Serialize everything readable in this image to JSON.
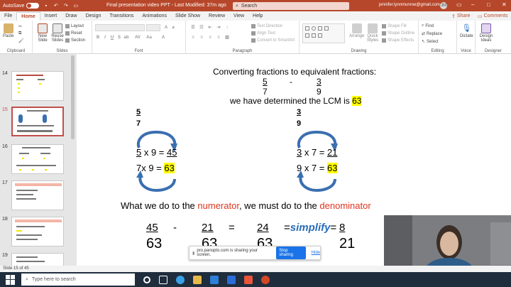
{
  "titlebar": {
    "autosave": "AutoSave",
    "autosave_state": "Off",
    "doc_title": "Final presentation video PPT  -  Last Modified: 37m ago",
    "search_placeholder": "Search",
    "user": "jennifer.lynnmunroe@gmail.com",
    "avatar_initials": "JM"
  },
  "tabs": [
    "File",
    "Home",
    "Insert",
    "Draw",
    "Design",
    "Transitions",
    "Animations",
    "Slide Show",
    "Review",
    "View",
    "Help"
  ],
  "active_tab": "Home",
  "share_label": "Share",
  "comments_label": "Comments",
  "ribbon": {
    "groups": {
      "clipboard": "Clipboard",
      "slides": "Slides",
      "font": "Font",
      "paragraph": "Paragraph",
      "drawing": "Drawing",
      "editing": "Editing",
      "voice": "Voice",
      "designer": "Designer"
    },
    "paste": "Paste",
    "new_slide": "New Slide",
    "reuse_slides": "Reuse Slides",
    "layout": "Layout",
    "reset": "Reset",
    "section": "Section",
    "text_direction": "Text Direction",
    "align_text": "Align Text",
    "convert_smartart": "Convert to SmartArt",
    "arrange": "Arrange",
    "quick_styles": "Quick Styles",
    "shape_fill": "Shape Fill",
    "shape_outline": "Shape Outline",
    "shape_effects": "Shape Effects",
    "find": "Find",
    "replace": "Replace",
    "select": "Select",
    "dictate": "Dictate",
    "design_ideas": "Design Ideas"
  },
  "thumbnails": [
    {
      "num": "14",
      "selected": false
    },
    {
      "num": "15",
      "selected": true
    },
    {
      "num": "16",
      "selected": false
    },
    {
      "num": "17",
      "selected": false
    },
    {
      "num": "18",
      "selected": false
    },
    {
      "num": "19",
      "selected": false
    }
  ],
  "slide": {
    "title": "Converting fractions to equivalent fractions:",
    "frac1_num": "5",
    "frac1_den": "7",
    "minus": "-",
    "frac2_num": "3",
    "frac2_den": "9",
    "lcm_text": "we have determined the LCM is",
    "lcm_value": "63",
    "left_num": "5",
    "left_den": "7",
    "left_eq1_a": "5",
    "left_eq1_b": " x 9 = ",
    "left_eq1_c": "45",
    "left_eq2_a": "7x 9 = ",
    "left_eq2_b": "63",
    "right_num": "3",
    "right_den": "9",
    "right_eq1_a": "3",
    "right_eq1_b": " x 7 = ",
    "right_eq1_c": "21",
    "right_eq2_a": "9 x 7 = ",
    "right_eq2_b": "63",
    "rule_a": "What we do to the ",
    "rule_numerator": "numerator",
    "rule_b": ", we must do to the ",
    "rule_denominator": "denominator",
    "bottom": {
      "n1": "45",
      "d1": "63",
      "op1": "-",
      "n2": "21",
      "d2": "63",
      "eq": "=",
      "n3": "24",
      "d3": "63",
      "simplify_pre": "=",
      "simplify": "simplify",
      "simplify_post": "=",
      "n4": "8",
      "d4": "21"
    }
  },
  "sharebar": {
    "message": "pro.panopto.com is sharing your screen.",
    "stop": "Stop sharing",
    "hide": "Hide"
  },
  "status_text": "Slide 15 of 45",
  "taskbar_search": "Type here to search",
  "colors": {
    "brand": "#b7472a",
    "highlight": "#ffff00",
    "numerator_red": "#e0341f",
    "arrow_blue": "#3a6fb0",
    "simplify_blue": "#2a6ebb"
  }
}
